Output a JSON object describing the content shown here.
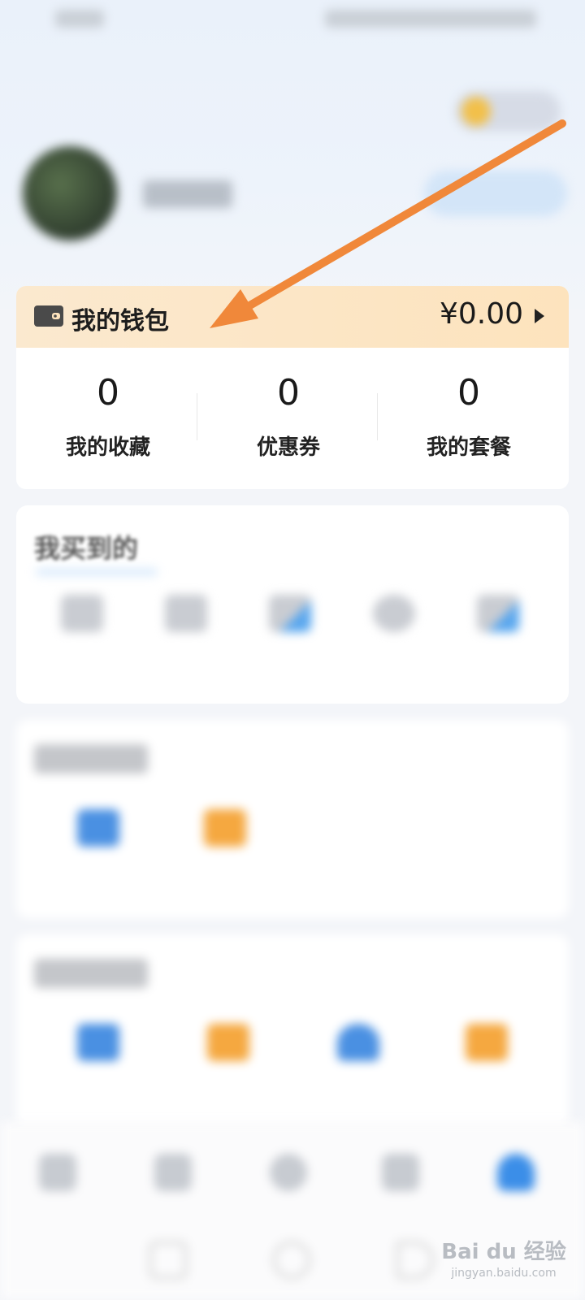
{
  "wallet": {
    "title": "我的钱包",
    "amount": "¥0.00"
  },
  "stats": [
    {
      "value": "0",
      "label": "我的收藏"
    },
    {
      "value": "0",
      "label": "优惠券"
    },
    {
      "value": "0",
      "label": "我的套餐"
    }
  ],
  "purchased": {
    "title": "我买到的"
  },
  "watermark": {
    "brand": "Bai du 经验",
    "url": "jingyan.baidu.com"
  },
  "colors": {
    "wallet_header": "#fde3bd",
    "accent_blue": "#3b8ee8",
    "annotation_arrow": "#f0883a"
  }
}
